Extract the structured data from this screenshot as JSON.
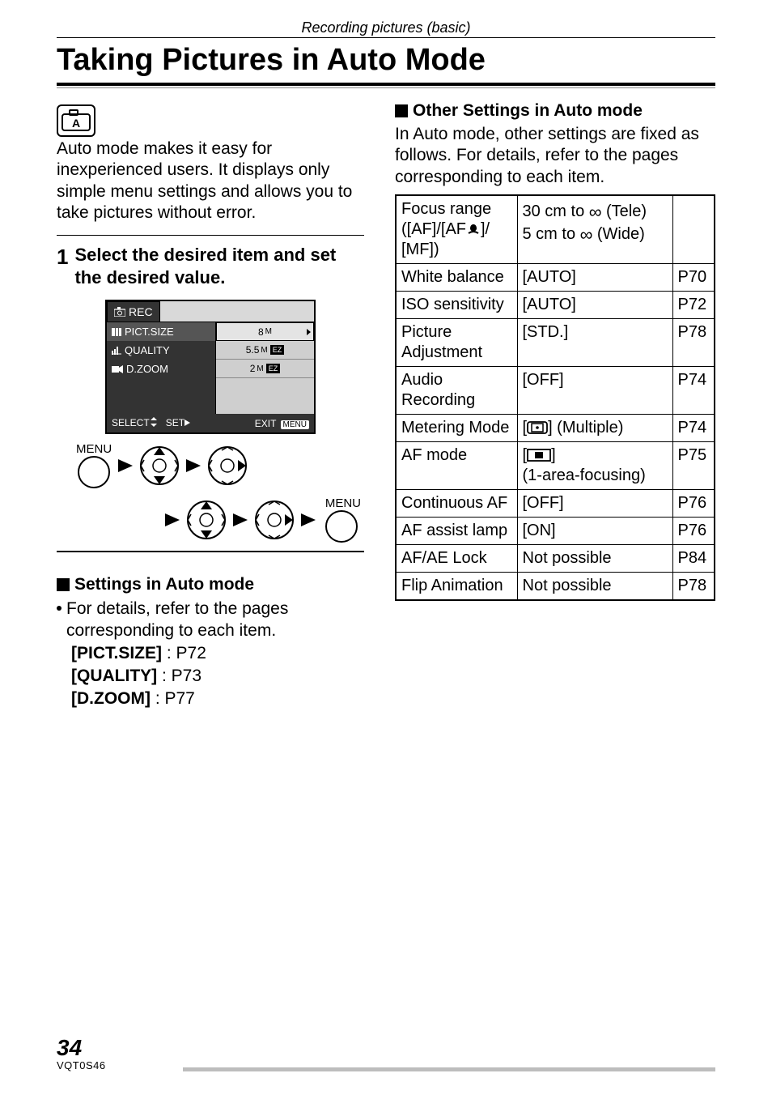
{
  "section_label": "Recording pictures (basic)",
  "page_title": "Taking Pictures in Auto Mode",
  "intro": "Auto mode makes it easy for inexperienced users. It displays only simple menu settings and allows you to take pictures without error.",
  "step": {
    "num": "1",
    "text": "Select the desired item and set the desired value."
  },
  "lcd": {
    "tab": "REC",
    "rows": [
      {
        "label": "PICT.SIZE",
        "value": "8",
        "unit": "M",
        "selected": true
      },
      {
        "label": "QUALITY",
        "value": "5.5",
        "unit": "M",
        "ez": true
      },
      {
        "label": "D.ZOOM",
        "value": "2",
        "unit": "M",
        "ez": true
      }
    ],
    "footer": {
      "select": "SELECT",
      "set": "SET",
      "exit": "EXIT",
      "menu": "MENU"
    }
  },
  "nav": {
    "menu_label": "MENU"
  },
  "settings_head": "Settings in Auto mode",
  "settings_intro": "For details, refer to the pages corresponding to each item.",
  "settings_items": [
    {
      "label": "[PICT.SIZE]",
      "page": ": P72"
    },
    {
      "label": "[QUALITY]",
      "page": ": P73"
    },
    {
      "label": "[D.ZOOM]",
      "page": ": P77"
    }
  ],
  "other_head": "Other Settings in Auto mode",
  "other_intro": "In Auto mode, other settings are fixed as follows. For details, refer to the pages corresponding to each item.",
  "table": [
    {
      "label_html": "Focus range<br>([AF]/[AF{macro}]/<br>[MF])",
      "value_html": "30 cm to {inf} (Tele)<br>5 cm to {inf} (Wide)",
      "page": ""
    },
    {
      "label_html": "White balance",
      "value_html": "[AUTO]",
      "page": "P70"
    },
    {
      "label_html": "ISO sensitivity",
      "value_html": "[AUTO]",
      "page": "P72"
    },
    {
      "label_html": "Picture Adjustment",
      "value_html": "[STD.]",
      "page": "P78"
    },
    {
      "label_html": "Audio Recording",
      "value_html": "[OFF]",
      "page": "P74"
    },
    {
      "label_html": "Metering Mode",
      "value_html": "[{meter}] (Multiple)",
      "page": "P74"
    },
    {
      "label_html": "AF mode",
      "value_html": "[{afarea}]<br>(1-area-focusing)",
      "page": "P75"
    },
    {
      "label_html": "Continuous AF",
      "value_html": "[OFF]",
      "page": "P76"
    },
    {
      "label_html": "AF assist lamp",
      "value_html": "[ON]",
      "page": "P76"
    },
    {
      "label_html": "AF/AE Lock",
      "value_html": "Not possible",
      "page": "P84"
    },
    {
      "label_html": "Flip Animation",
      "value_html": "Not possible",
      "page": "P78"
    }
  ],
  "footer": {
    "pagenum": "34",
    "docid": "VQT0S46"
  }
}
